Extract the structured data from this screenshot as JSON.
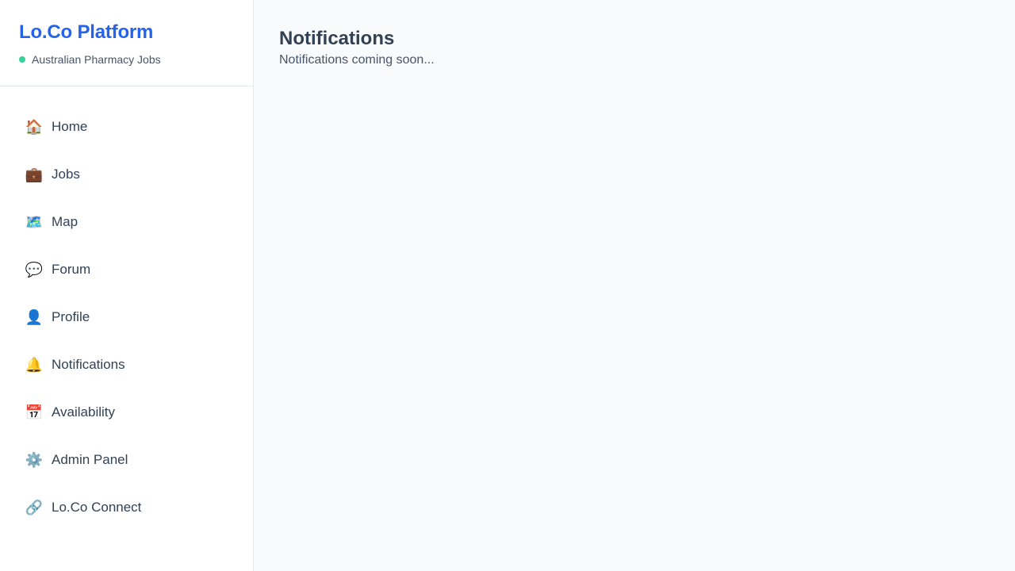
{
  "brand": {
    "title": "Lo.Co Platform",
    "subtitle": "Australian Pharmacy Jobs",
    "accent": "#2563eb",
    "status_color": "#34d399"
  },
  "sidebar": {
    "items": [
      {
        "label": "Home",
        "icon": "house-icon",
        "glyph": "🏠"
      },
      {
        "label": "Jobs",
        "icon": "briefcase-icon",
        "glyph": "💼"
      },
      {
        "label": "Map",
        "icon": "map-icon",
        "glyph": "🗺️"
      },
      {
        "label": "Forum",
        "icon": "speech-bubble-icon",
        "glyph": "💬"
      },
      {
        "label": "Profile",
        "icon": "user-icon",
        "glyph": "👤"
      },
      {
        "label": "Notifications",
        "icon": "bell-icon",
        "glyph": "🔔"
      },
      {
        "label": "Availability",
        "icon": "calendar-icon",
        "glyph": "📅"
      },
      {
        "label": "Admin Panel",
        "icon": "gear-icon",
        "glyph": "⚙️"
      },
      {
        "label": "Lo.Co Connect",
        "icon": "link-icon",
        "glyph": "🔗"
      }
    ]
  },
  "main": {
    "title": "Notifications",
    "message": "Notifications coming soon..."
  }
}
